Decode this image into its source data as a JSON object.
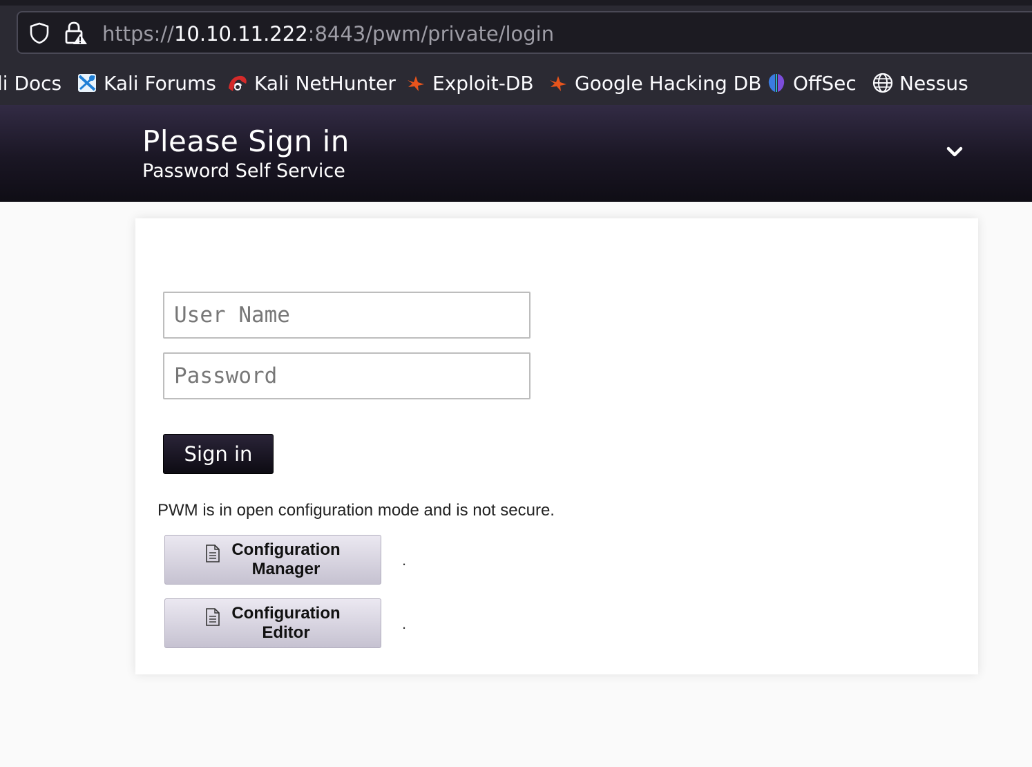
{
  "browser": {
    "url": {
      "scheme": "https://",
      "host": "10.10.11.222",
      "rest": ":8443/pwm/private/login"
    },
    "bookmarks": [
      {
        "label": "li Docs",
        "icon": "kali-docs-icon"
      },
      {
        "label": "Kali Forums",
        "icon": "kali-forums-icon"
      },
      {
        "label": "Kali NetHunter",
        "icon": "nethunter-icon"
      },
      {
        "label": "Exploit-DB",
        "icon": "exploit-db-icon"
      },
      {
        "label": "Google Hacking DB",
        "icon": "ghdb-icon"
      },
      {
        "label": "OffSec",
        "icon": "offsec-icon"
      },
      {
        "label": "Nessus",
        "icon": "globe-icon"
      }
    ]
  },
  "header": {
    "title": "Please Sign in",
    "subtitle": "Password Self Service"
  },
  "login": {
    "username_placeholder": "User Name",
    "password_placeholder": "Password",
    "signin_label": "Sign in"
  },
  "config": {
    "warning": "PWM is in open configuration mode and is not secure.",
    "manager_label": "Configuration\nManager",
    "manager_desc": ".",
    "editor_label": "Configuration\nEditor",
    "editor_desc": "."
  },
  "colors": {
    "chrome_bg": "#2b2a33",
    "header_bg": "#1a1624",
    "accent_exploit": "#e8541c"
  }
}
